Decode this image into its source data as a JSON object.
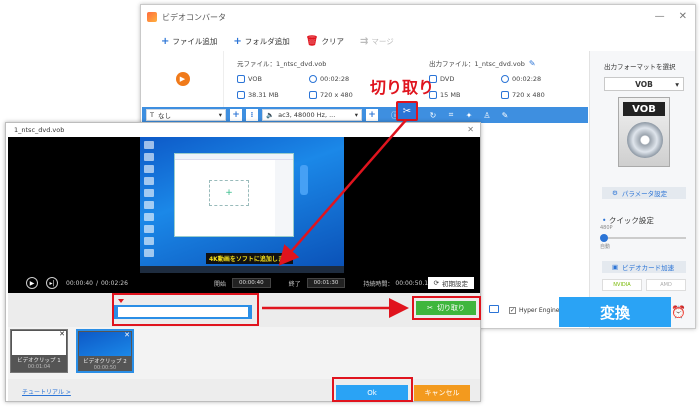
{
  "main_window": {
    "title": "ビデオコンバータ",
    "toolbar": {
      "add_file": "ファイル追加",
      "add_folder": "フォルダ追加",
      "clear": "クリア",
      "merge": "マージ"
    },
    "source": {
      "file": "元ファイル：1_ntsc_dvd.vob",
      "format": "VOB",
      "duration": "00:02:28",
      "size": "38.31 MB",
      "resolution": "720 x 480"
    },
    "output": {
      "file": "出力ファイル：1_ntsc_dvd.vob",
      "format": "DVD",
      "duration": "00:02:28",
      "size": "15 MB",
      "resolution": "720 x 480"
    },
    "editbar": {
      "subtitle": "なし",
      "audio": "ac3, 48000 Hz, ..."
    },
    "callout": "切り取り"
  },
  "right_panel": {
    "title": "出力フォーマットを選択",
    "format": "VOB",
    "format_label": "VOB",
    "param_button": "パラメータ設定",
    "quick_setting": "クイック設定",
    "slider_top": "480P",
    "slider_bottom": "自動",
    "gpu_button": "ビデオカード加速",
    "gpu_nvidia": "NVIDIA",
    "gpu_amd": "AMD",
    "hyper_engine": "Hyper Engine",
    "convert_button": "変換"
  },
  "edit_dialog": {
    "title": "1_ntsc_dvd.vob",
    "caption": "4K動画をソフトに追加します",
    "current_time": "00:00:40",
    "total_time": "00:02:26",
    "start_label": "開始",
    "start_value": "00:00:40",
    "end_label": "終了",
    "end_value": "00:01:30",
    "duration_label": "持続時間：",
    "duration_value": "00:00:50.170",
    "reset_button": "初期設定",
    "cut_button": "切り取り",
    "clips": [
      {
        "name": "ビデオクリップ 1",
        "time": "00:01:04"
      },
      {
        "name": "ビデオクリップ 2",
        "time": "00:00:50"
      }
    ],
    "tutorial_link": "チュートリアル >",
    "ok_button": "Ok",
    "cancel_button": "キャンセル"
  }
}
